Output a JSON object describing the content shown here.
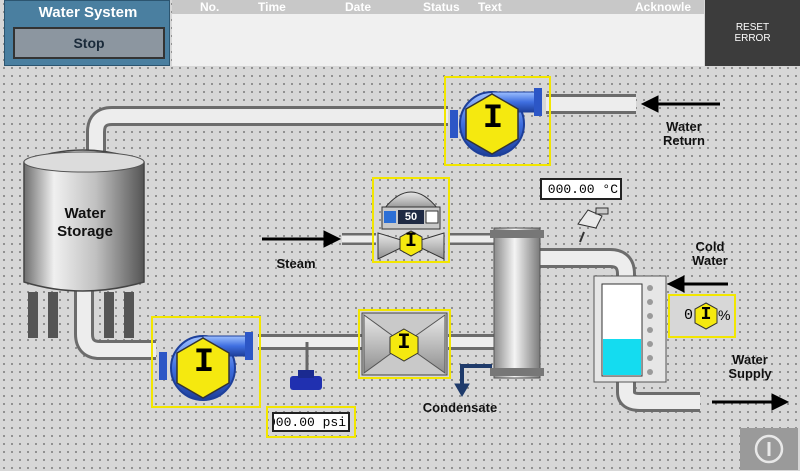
{
  "header": {
    "title": "Water System",
    "stop_label": "Stop",
    "alarm_columns": [
      "No.",
      "Time",
      "Date",
      "Status",
      "Text",
      "Acknowle"
    ],
    "reset_label_1": "RESET",
    "reset_label_2": "ERROR"
  },
  "labels": {
    "water_storage_1": "Water",
    "water_storage_2": "Storage",
    "water_return_1": "Water",
    "water_return_2": "Return",
    "steam": "Steam",
    "cold_water_1": "Cold",
    "cold_water_2": "Water",
    "condensate": "Condensate",
    "water_supply_1": "Water",
    "water_supply_2": "Supply"
  },
  "values": {
    "temperature": "000.00 °C",
    "pressure": "000.00 psi",
    "steam_valve_position": "50",
    "level_prefix": "0",
    "level_unit": "%"
  },
  "status_glyph": "I",
  "tank_level_fraction": 0.4,
  "colors": {
    "pipe": "#c8c8c8",
    "accent": "#f2e600",
    "pump_blue": "#3f6fe0",
    "water": "#14dcf0"
  },
  "icons": [
    "pump-icon",
    "valve-icon",
    "heat-exchanger-icon",
    "tank-icon",
    "temperature-sensor-icon",
    "pressure-sensor-icon",
    "info-icon"
  ]
}
